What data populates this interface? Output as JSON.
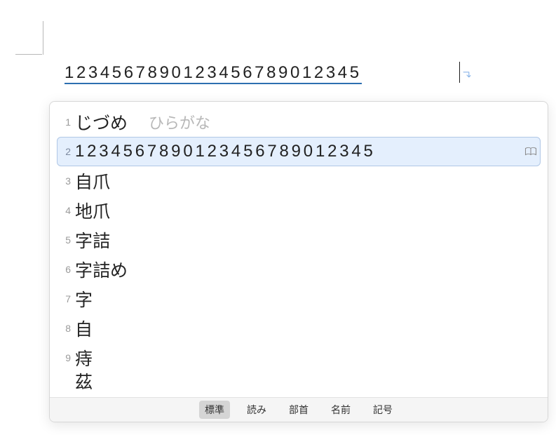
{
  "input": {
    "text": "1234567890123456789012345"
  },
  "candidates": {
    "items": [
      {
        "num": "1",
        "word": "じづめ",
        "hint": "ひらがな"
      },
      {
        "num": "2",
        "full": "1234567890123456789012345",
        "selected": true
      },
      {
        "num": "3",
        "word": "自爪"
      },
      {
        "num": "4",
        "word": "地爪"
      },
      {
        "num": "5",
        "word": "字詰"
      },
      {
        "num": "6",
        "word": "字詰め"
      },
      {
        "num": "7",
        "word": "字"
      },
      {
        "num": "8",
        "word": "自"
      },
      {
        "num": "9",
        "word": "痔"
      },
      {
        "num": "",
        "word": "茲"
      }
    ]
  },
  "tabs": {
    "standard": "標準",
    "reading": "読み",
    "radical": "部首",
    "name": "名前",
    "symbol": "記号"
  },
  "colors": {
    "underline": "#2d6fb0",
    "selection_bg": "#e4effd",
    "selection_border": "#b0c7e6"
  }
}
